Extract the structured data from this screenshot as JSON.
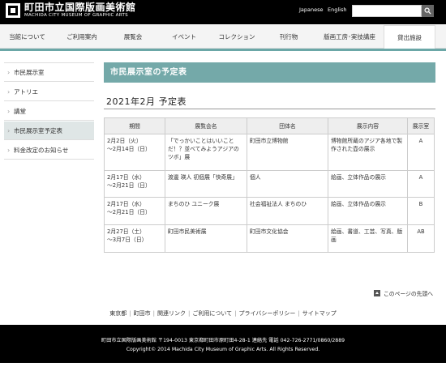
{
  "header": {
    "logo_ja": "町田市立国際版画美術館",
    "logo_en": "MACHIDA CITY MUSEUM OF GRAPHIC ARTS",
    "lang_japanese": "Japanese",
    "lang_english": "English",
    "search_placeholder": ""
  },
  "nav": [
    {
      "label": "当館について"
    },
    {
      "label": "ご利用案内"
    },
    {
      "label": "展覧会"
    },
    {
      "label": "イベント"
    },
    {
      "label": "コレクション"
    },
    {
      "label": "刊行物"
    },
    {
      "label": "版画工房･実技講座"
    },
    {
      "label": "貸出施設"
    }
  ],
  "sidebar": {
    "items": [
      {
        "label": "市民展示室"
      },
      {
        "label": "アトリエ"
      },
      {
        "label": "講堂"
      },
      {
        "label": "市民展示室予定表"
      },
      {
        "label": "料金改定のお知らせ"
      }
    ]
  },
  "main": {
    "page_title": "市民展示室の予定表",
    "section_title": "2021年2月 予定表"
  },
  "chart_data": {
    "type": "table",
    "columns": [
      "期間",
      "展覧会名",
      "団体名",
      "展示内容",
      "展示室"
    ],
    "rows": [
      {
        "period": [
          "2月2日（火）",
          "～2月14日（日）"
        ],
        "title": "「でっかいことはいいことだ！？並べてみようアジアのツボ」展",
        "org": "町田市立博物館",
        "content": "博物館所蔵のアジア各地で製作された壺の展示",
        "room": "A"
      },
      {
        "period": [
          "2月17日（水）",
          "～2月21日（日）"
        ],
        "title": "渡邊 瑛人 初個展「快奇展」",
        "org": "個人",
        "content": "絵画、立体作品の展示",
        "room": "A"
      },
      {
        "period": [
          "2月17日（水）",
          "～2月21日（日）"
        ],
        "title": "まちのひ ユニーク展",
        "org": "社会福祉法人 まちのひ",
        "content": "絵画、立体作品の展示",
        "room": "B"
      },
      {
        "period": [
          "2月27日（土）",
          "～3月7日（日）"
        ],
        "title": "町田市民美術展",
        "org": "町田市文化協会",
        "content": "絵画、書道、工芸、写真、版画",
        "room": "AB"
      }
    ]
  },
  "pagetop": {
    "label": "このページの先頭へ"
  },
  "footer": {
    "links": [
      "東京都",
      "町田市",
      "関連リンク",
      "ご利用について",
      "プライバシーポリシー",
      "サイトマップ"
    ],
    "address": "町田市立国際版画美術館 〒194-0013 東京都町田市原町田4-28-1 連絡先 電話 042-726-2771/0860/2889",
    "copyright": "Copyright© 2014 Machida City Museum of Graphic Arts. All Rights Reserved."
  }
}
